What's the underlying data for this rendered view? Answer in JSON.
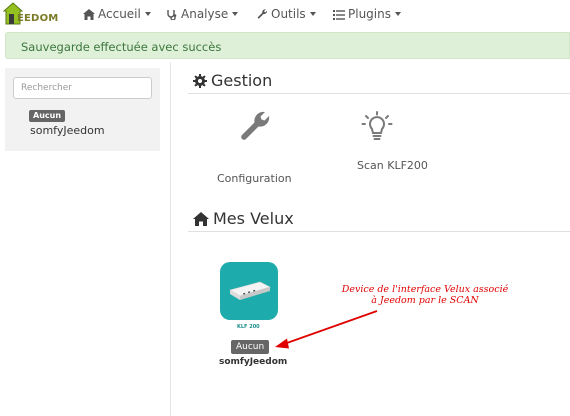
{
  "nav": {
    "brand": "EEDOM",
    "items": [
      {
        "label": "Accueil",
        "icon": "home-icon"
      },
      {
        "label": "Analyse",
        "icon": "stethoscope-icon"
      },
      {
        "label": "Outils",
        "icon": "wrench-icon"
      },
      {
        "label": "Plugins",
        "icon": "list-icon"
      }
    ]
  },
  "alert": {
    "message": "Sauvegarde effectuée avec succès"
  },
  "sidebar": {
    "search_placeholder": "Rechercher",
    "items": [
      {
        "badge": "Aucun",
        "name": "somfyJeedom"
      }
    ]
  },
  "gestion": {
    "title": "Gestion",
    "cards": [
      {
        "label": "Configuration",
        "icon": "wrench-icon"
      },
      {
        "label": "Scan KLF200",
        "icon": "lightbulb-icon"
      }
    ]
  },
  "velux": {
    "title": "Mes Velux",
    "equipment": {
      "device_caption": "KLF 200",
      "badge": "Aucun",
      "name": "somfyJeedom"
    },
    "annotation": {
      "line1": "Device de l'interface Velux associé",
      "line2": "à Jeedom par le SCAN"
    }
  },
  "colors": {
    "alert_bg": "#dff0d8",
    "alert_text": "#3c763d",
    "device_teal": "#1eabab",
    "annotation": "#e00000"
  }
}
